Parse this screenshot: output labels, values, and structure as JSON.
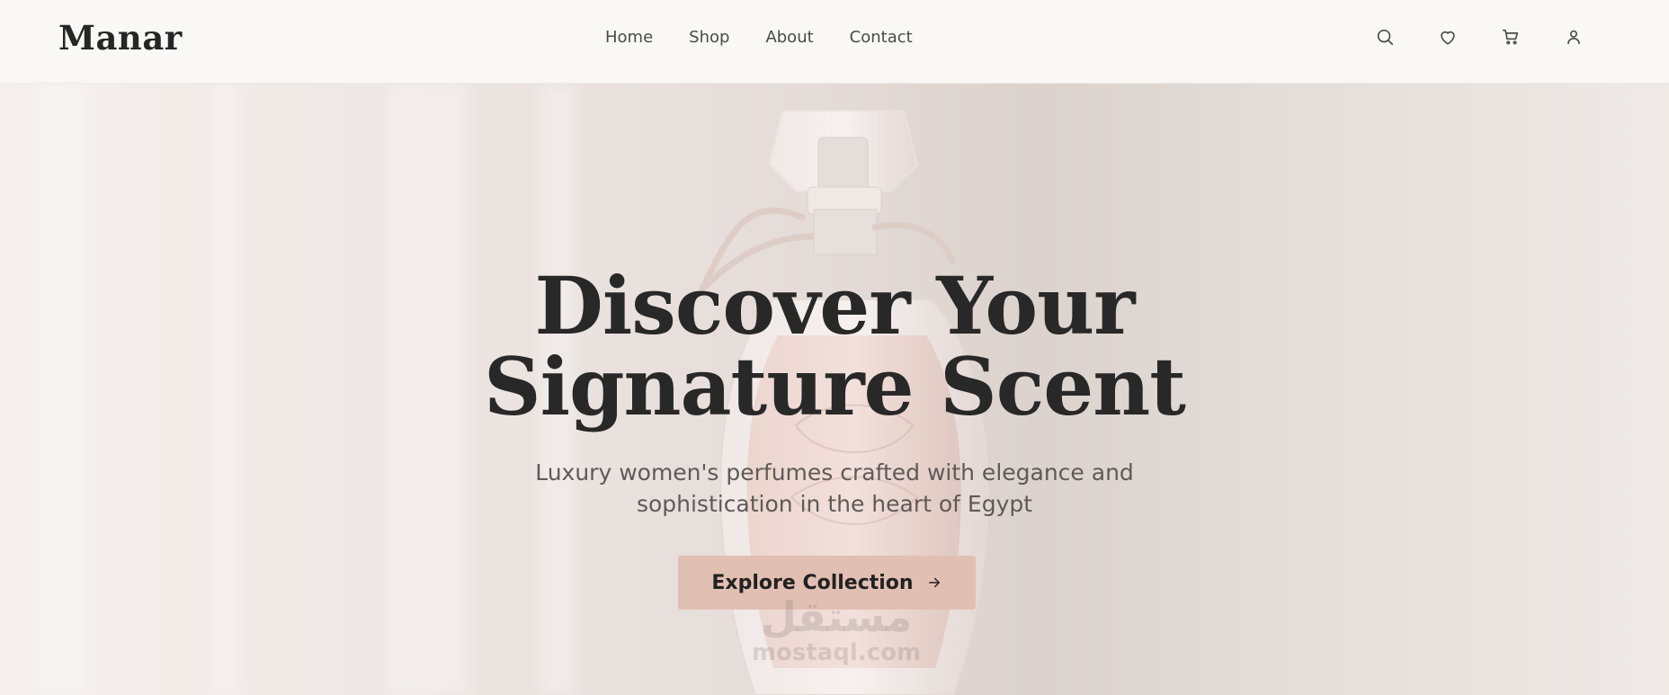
{
  "brand": {
    "name": "Manar"
  },
  "nav": {
    "items": [
      {
        "label": "Home"
      },
      {
        "label": "Shop"
      },
      {
        "label": "About"
      },
      {
        "label": "Contact"
      }
    ],
    "icons": [
      "search-icon",
      "heart-icon",
      "cart-icon",
      "user-icon"
    ]
  },
  "hero": {
    "headline": "Discover Your Signature Scent",
    "subtitle": "Luxury women's perfumes crafted with elegance and sophistication in the heart of Egypt",
    "cta_label": "Explore Collection",
    "cta_icon": "arrow-right-icon"
  },
  "watermark": {
    "arabic": "مستقل",
    "latin": "mostaql.com"
  },
  "colors": {
    "cta_background": "#e2bfb3",
    "text_dark": "#282828",
    "nav_background": "#f9f8f6"
  }
}
